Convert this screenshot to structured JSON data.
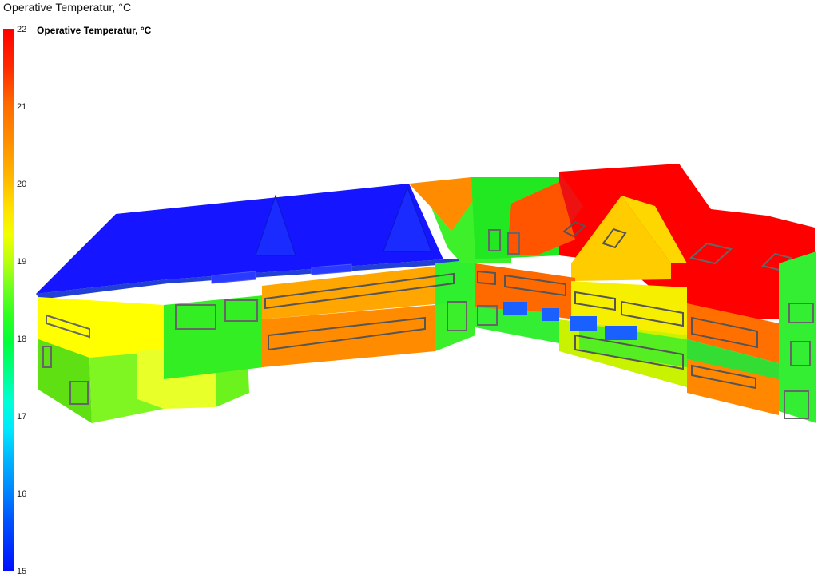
{
  "window": {
    "title": "Operative Temperatur, °C"
  },
  "legend": {
    "label": "Operative Temperatur, °C",
    "ticks": [
      "22",
      "21",
      "20",
      "19",
      "18",
      "17",
      "16",
      "15"
    ],
    "min": 15,
    "max": 22,
    "colors": {
      "high": "#ff0000",
      "mid": "#ffff00",
      "low_mid": "#00ff00",
      "cool": "#00ffff",
      "low": "#0000ff"
    }
  },
  "model": {
    "description_colors": {
      "roof_west": "#1a1aff",
      "roof_east": "#ff1a1a",
      "gable_yellow": "#ffd200",
      "wall_green": "#33ff33",
      "wall_orange": "#ff8800",
      "wall_yellow": "#eeff00"
    }
  }
}
